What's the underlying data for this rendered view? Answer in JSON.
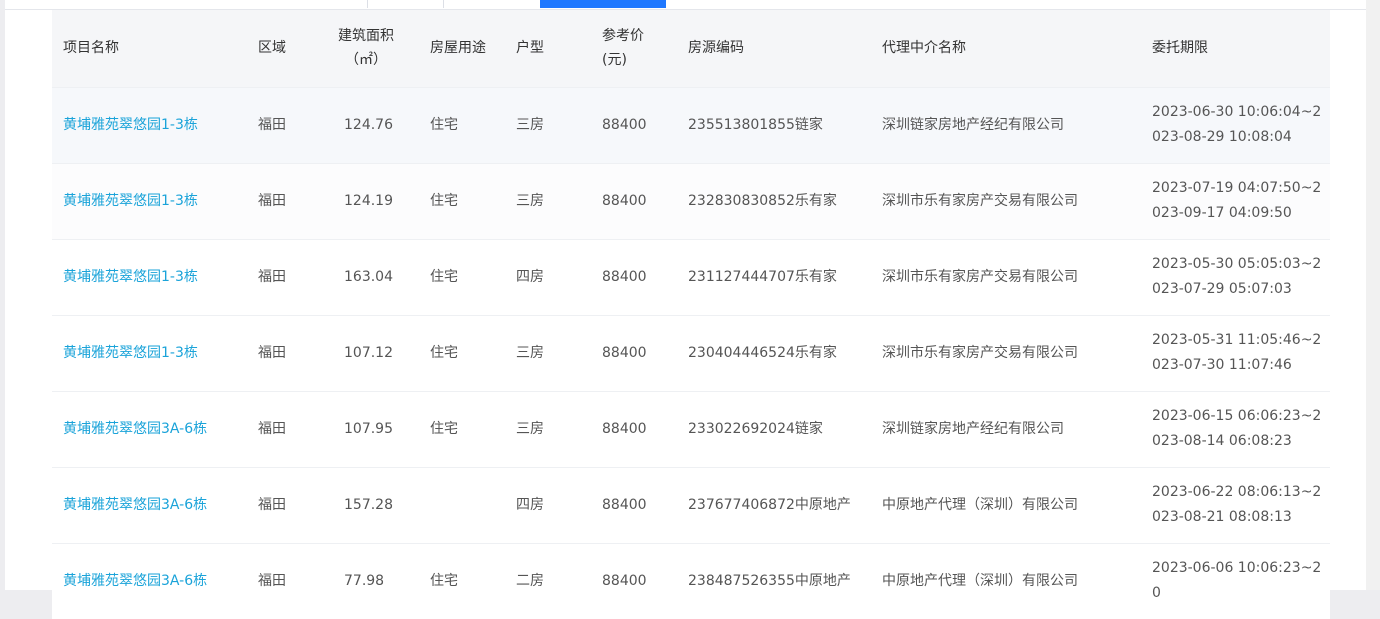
{
  "table": {
    "headers": {
      "name": "项目名称",
      "area": "区域",
      "size_line1": "建筑面积",
      "size_line2": "（㎡）",
      "use": "房屋用途",
      "type": "户型",
      "price_line1": "参考价",
      "price_line2": "(元)",
      "code": "房源编码",
      "agent": "代理中介名称",
      "period": "委托期限"
    },
    "rows": [
      {
        "name": "黄埔雅苑翠悠园1-3栋",
        "area": "福田",
        "size": "124.76",
        "use": "住宅",
        "type": "三房",
        "price": "88400",
        "code": "235513801855链家",
        "agent": "深圳链家房地产经纪有限公司",
        "period": "2023-06-30 10:06:04~2023-08-29 10:08:04"
      },
      {
        "name": "黄埔雅苑翠悠园1-3栋",
        "area": "福田",
        "size": "124.19",
        "use": "住宅",
        "type": "三房",
        "price": "88400",
        "code": "232830830852乐有家",
        "agent": "深圳市乐有家房产交易有限公司",
        "period": "2023-07-19 04:07:50~2023-09-17 04:09:50"
      },
      {
        "name": "黄埔雅苑翠悠园1-3栋",
        "area": "福田",
        "size": "163.04",
        "use": "住宅",
        "type": "四房",
        "price": "88400",
        "code": "231127444707乐有家",
        "agent": "深圳市乐有家房产交易有限公司",
        "period": "2023-05-30 05:05:03~2023-07-29 05:07:03"
      },
      {
        "name": "黄埔雅苑翠悠园1-3栋",
        "area": "福田",
        "size": "107.12",
        "use": "住宅",
        "type": "三房",
        "price": "88400",
        "code": "230404446524乐有家",
        "agent": "深圳市乐有家房产交易有限公司",
        "period": "2023-05-31 11:05:46~2023-07-30 11:07:46"
      },
      {
        "name": "黄埔雅苑翠悠园3A-6栋",
        "area": "福田",
        "size": "107.95",
        "use": "住宅",
        "type": "三房",
        "price": "88400",
        "code": "233022692024链家",
        "agent": "深圳链家房地产经纪有限公司",
        "period": "2023-06-15 06:06:23~2023-08-14 06:08:23"
      },
      {
        "name": "黄埔雅苑翠悠园3A-6栋",
        "area": "福田",
        "size": "157.28",
        "use": "",
        "type": "四房",
        "price": "88400",
        "code": "237677406872中原地产",
        "agent": "中原地产代理（深圳）有限公司",
        "period": "2023-06-22 08:06:13~2023-08-21 08:08:13"
      },
      {
        "name": "黄埔雅苑翠悠园3A-6栋",
        "area": "福田",
        "size": "77.98",
        "use": "住宅",
        "type": "二房",
        "price": "88400",
        "code": "238487526355中原地产",
        "agent": "中原地产代理（深圳）有限公司",
        "period": "2023-06-06 10:06:23~20"
      }
    ]
  },
  "colors": {
    "link": "#1aa3d9",
    "active_tab": "#1f78ff",
    "header_bg": "#f5f6f8"
  }
}
